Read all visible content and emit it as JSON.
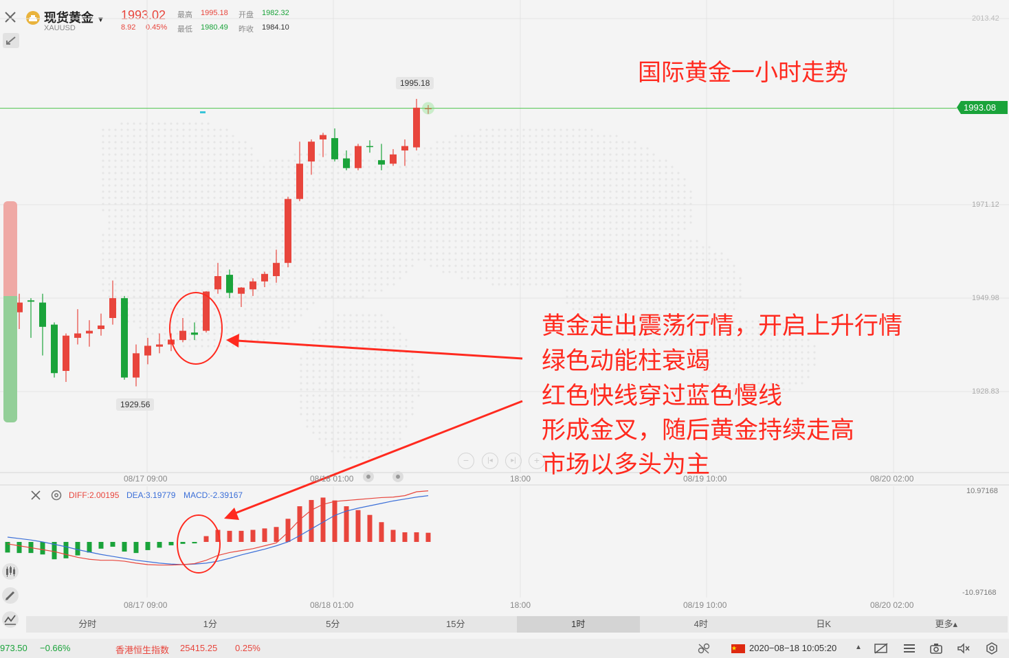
{
  "header": {
    "instrument_name": "现货黄金",
    "symbol": "XAUUSD",
    "last_price": "1993.02",
    "change": "8.92",
    "change_pct": "0.45%",
    "high_label": "最高",
    "high_value": "1995.18",
    "low_label": "最低",
    "low_value": "1980.49",
    "open_label": "开盘",
    "open_value": "1982.32",
    "prev_close_label": "昨收",
    "prev_close_value": "1984.10"
  },
  "annotations": {
    "title": "国际黄金一小时走势",
    "lines": [
      "黄金走出震荡行情，开启上升行情",
      "绿色动能柱衰竭",
      "红色快线穿过蓝色慢线",
      "形成金叉，随后黄金持续走高",
      "市场以多头为主"
    ]
  },
  "main_chart": {
    "price_axis_labels": [
      "2013.42",
      "1971.12",
      "1949.98",
      "1928.83"
    ],
    "current_price_tag": "1993.08",
    "high_marker": "1995.18",
    "low_marker": "1929.56",
    "time_labels": [
      "08/17 09:00",
      "08/18 01:00",
      "18:00",
      "08/19 10:00",
      "08/20 02:00"
    ]
  },
  "macd_panel": {
    "diff_label": "DIFF:2.00195",
    "dea_label": "DEA:3.19779",
    "macd_label": "MACD:-2.39167",
    "axis_top": "10.97168",
    "axis_bottom": "-10.97168",
    "time_labels": [
      "08/17 09:00",
      "08/18 01:00",
      "18:00",
      "08/19 10:00",
      "08/20 02:00"
    ]
  },
  "timeframe_tabs": [
    "分时",
    "1分",
    "5分",
    "15分",
    "1时",
    "4时",
    "日K",
    "更多▴"
  ],
  "active_tab": "1时",
  "status_bar": {
    "left_value": "973.50",
    "left_change": "−0.66%",
    "index_name": "香港恒生指数",
    "index_value": "25415.25",
    "index_change": "0.25%",
    "datetime": "2020−08−18 10:05:20"
  },
  "colors": {
    "up": "#e8453c",
    "down": "#1aa33a",
    "dea_line": "#3b6fd8",
    "annotation": "#ff2a1f",
    "price_line": "#4cc44c"
  },
  "chart_data": {
    "type": "candlestick",
    "price_range": [
      1920,
      2016
    ],
    "candles": [
      {
        "o": 1949.5,
        "h": 1955,
        "c": 1947.0,
        "l": 1944
      },
      {
        "o": 1946.8,
        "h": 1951,
        "c": 1949.0,
        "l": 1943
      },
      {
        "o": 1949.5,
        "h": 1950,
        "c": 1949.2,
        "l": 1941
      },
      {
        "o": 1949.0,
        "h": 1951,
        "c": 1943.5,
        "l": 1937
      },
      {
        "o": 1944.0,
        "h": 1944.5,
        "c": 1933.0,
        "l": 1932
      },
      {
        "o": 1933.5,
        "h": 1942.0,
        "c": 1941.5,
        "l": 1931
      },
      {
        "o": 1941.0,
        "h": 1947.5,
        "c": 1942.0,
        "l": 1939.5
      },
      {
        "o": 1942.0,
        "h": 1945.0,
        "c": 1942.6,
        "l": 1939
      },
      {
        "o": 1943.0,
        "h": 1946.5,
        "c": 1943.8,
        "l": 1941.5
      },
      {
        "o": 1945.5,
        "h": 1954.0,
        "c": 1950.0,
        "l": 1944
      },
      {
        "o": 1950.0,
        "h": 1950.5,
        "c": 1932.0,
        "l": 1931.5
      },
      {
        "o": 1932.0,
        "h": 1939.5,
        "c": 1937.5,
        "l": 1930
      },
      {
        "o": 1937.0,
        "h": 1941.0,
        "c": 1939.2,
        "l": 1935
      },
      {
        "o": 1939.0,
        "h": 1942.0,
        "c": 1939.5,
        "l": 1937.5
      },
      {
        "o": 1939.5,
        "h": 1942.0,
        "c": 1940.6,
        "l": 1938
      },
      {
        "o": 1940.5,
        "h": 1945.5,
        "c": 1942.6,
        "l": 1940
      },
      {
        "o": 1942.2,
        "h": 1944.5,
        "c": 1941.7,
        "l": 1940.5
      },
      {
        "o": 1942.6,
        "h": 1951.6,
        "c": 1951.5,
        "l": 1942.2
      },
      {
        "o": 1952.0,
        "h": 1958.0,
        "c": 1955.0,
        "l": 1951.0
      },
      {
        "o": 1955.3,
        "h": 1956.5,
        "c": 1951.2,
        "l": 1950.0
      },
      {
        "o": 1951.0,
        "h": 1952.5,
        "c": 1952.4,
        "l": 1948.0
      },
      {
        "o": 1952.0,
        "h": 1954.5,
        "c": 1953.8,
        "l": 1950.5
      },
      {
        "o": 1953.8,
        "h": 1956.0,
        "c": 1955.5,
        "l": 1952.5
      },
      {
        "o": 1955.0,
        "h": 1961.0,
        "c": 1958.0,
        "l": 1953.5
      },
      {
        "o": 1958.0,
        "h": 1973.0,
        "c": 1972.5,
        "l": 1957.0
      },
      {
        "o": 1972.5,
        "h": 1985.5,
        "c": 1980.5,
        "l": 1972.0
      },
      {
        "o": 1981.0,
        "h": 1986.0,
        "c": 1985.5,
        "l": 1978.0
      },
      {
        "o": 1986.0,
        "h": 1987.5,
        "c": 1987.0,
        "l": 1982.0
      },
      {
        "o": 1986.3,
        "h": 1988.5,
        "c": 1981.5,
        "l": 1981.0
      },
      {
        "o": 1981.7,
        "h": 1983.5,
        "c": 1979.5,
        "l": 1979.0
      },
      {
        "o": 1979.5,
        "h": 1985.0,
        "c": 1984.5,
        "l": 1979.0
      },
      {
        "o": 1984.5,
        "h": 1985.8,
        "c": 1984.3,
        "l": 1983.0
      },
      {
        "o": 1981.3,
        "h": 1985.0,
        "c": 1980.3,
        "l": 1979.0
      },
      {
        "o": 1980.5,
        "h": 1983.8,
        "c": 1982.6,
        "l": 1980.0
      },
      {
        "o": 1983.5,
        "h": 1986.0,
        "c": 1984.5,
        "l": 1980.0
      },
      {
        "o": 1984.2,
        "h": 1995.2,
        "c": 1993.2,
        "l": 1983.5
      },
      {
        "o": 1993.0,
        "h": 1993.8,
        "c": 1993.1,
        "l": 1991.8
      }
    ],
    "macd_range": [
      -10.97168,
      10.97168
    ],
    "macd_hist": [
      -2.2,
      -2.3,
      -2.3,
      -2.6,
      -3.6,
      -3.4,
      -2.8,
      -2.2,
      -1.4,
      -1.0,
      -2.0,
      -2.3,
      -1.7,
      -1.2,
      -0.7,
      -0.4,
      -0.3,
      1.2,
      2.5,
      2.3,
      2.3,
      2.5,
      2.8,
      3.1,
      4.8,
      7.4,
      8.7,
      9.2,
      8.6,
      7.4,
      6.6,
      5.6,
      4.1,
      2.5,
      2.0,
      2.0,
      1.9
    ],
    "diff": [
      -0.4,
      -0.8,
      -1.2,
      -1.6,
      -2.0,
      -2.6,
      -3.2,
      -3.6,
      -3.8,
      -3.8,
      -4.0,
      -4.4,
      -4.7,
      -4.8,
      -4.8,
      -4.7,
      -4.5,
      -3.8,
      -2.8,
      -2.2,
      -1.8,
      -1.4,
      -0.8,
      -0.2,
      2.0,
      4.6,
      6.6,
      7.8,
      8.4,
      8.6,
      8.8,
      9.0,
      9.2,
      9.3,
      9.6,
      10.4,
      10.6
    ],
    "dea": [
      1.0,
      0.7,
      0.4,
      0.0,
      -0.5,
      -1.0,
      -1.6,
      -2.1,
      -2.6,
      -3.0,
      -3.4,
      -3.8,
      -4.1,
      -4.4,
      -4.6,
      -4.7,
      -4.6,
      -4.4,
      -4.0,
      -3.4,
      -2.7,
      -2.1,
      -1.5,
      -0.8,
      0.0,
      1.3,
      2.7,
      4.1,
      5.5,
      6.4,
      7.0,
      7.5,
      8.0,
      8.5,
      8.9,
      9.3,
      9.6
    ]
  }
}
